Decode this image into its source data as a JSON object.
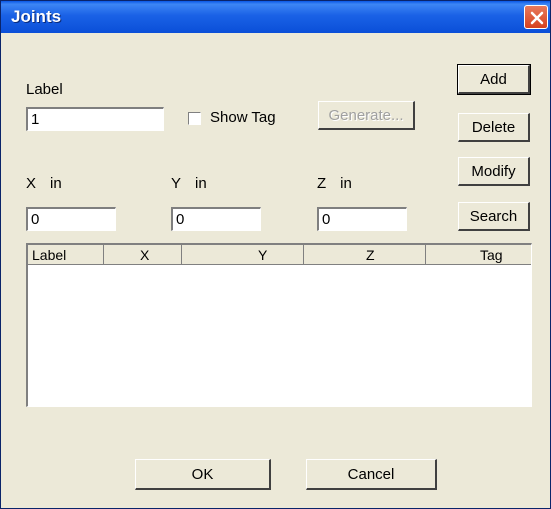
{
  "window": {
    "title": "Joints"
  },
  "form": {
    "label_caption": "Label",
    "label_value": "1",
    "show_tag_label": "Show Tag",
    "generate_label": "Generate...",
    "x_label": "X",
    "y_label": "Y",
    "z_label": "Z",
    "unit": "in",
    "x_value": "0",
    "y_value": "0",
    "z_value": "0"
  },
  "side_buttons": {
    "add": "Add",
    "delete": "Delete",
    "modify": "Modify",
    "search": "Search"
  },
  "list": {
    "columns": [
      "Label",
      "X",
      "Y",
      "Z",
      "Tag"
    ]
  },
  "footer": {
    "ok": "OK",
    "cancel": "Cancel"
  },
  "icons": {
    "close": "close-icon"
  }
}
